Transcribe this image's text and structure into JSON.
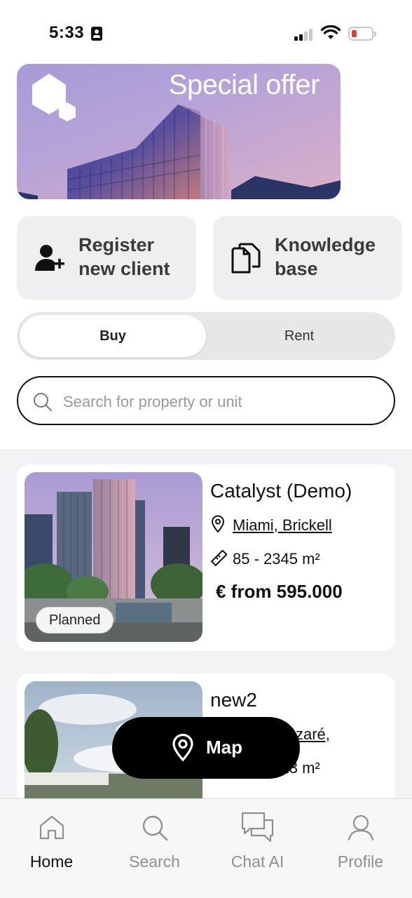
{
  "status_bar": {
    "time": "5:33"
  },
  "banner": {
    "title": "Special offer"
  },
  "actions": [
    {
      "label": "Register new client",
      "icon": "person-add-icon"
    },
    {
      "label": "Knowledge base",
      "icon": "documents-icon"
    }
  ],
  "segment": {
    "buy": "Buy",
    "rent": "Rent",
    "selected": "Buy"
  },
  "search": {
    "placeholder": "Search for property or unit"
  },
  "properties": [
    {
      "title": "Catalyst (Demo)",
      "location": "Miami, Brickell",
      "area": "85 - 2345 m²",
      "price": "€ from 595.000",
      "badge": "Planned"
    },
    {
      "title": "new2",
      "location": "zaré,",
      "area": "123 - 123 m²"
    }
  ],
  "map_button": {
    "label": "Map"
  },
  "nav": [
    {
      "label": "Home",
      "icon": "home-icon",
      "active": true
    },
    {
      "label": "Search",
      "icon": "search-icon",
      "active": false
    },
    {
      "label": "Chat AI",
      "icon": "chat-icon",
      "active": false
    },
    {
      "label": "Profile",
      "icon": "profile-icon",
      "active": false
    }
  ],
  "colors": {
    "accent": "#000000",
    "muted": "#8e8e93",
    "card_bg": "#efeff1",
    "battery_low": "#e23b3b"
  }
}
